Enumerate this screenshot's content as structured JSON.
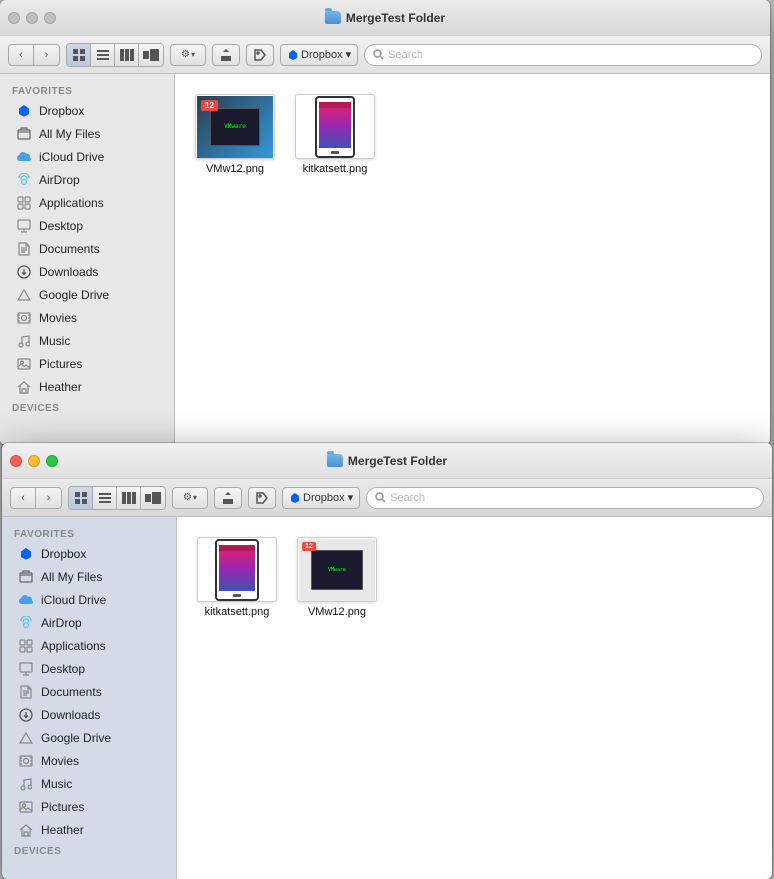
{
  "window1": {
    "title": "MergeTest Folder",
    "active": false,
    "sidebar": {
      "section": "Favorites",
      "items": [
        {
          "id": "dropbox",
          "label": "Dropbox",
          "icon": "dropbox"
        },
        {
          "id": "all-my-files",
          "label": "All My Files",
          "icon": "files"
        },
        {
          "id": "icloud-drive",
          "label": "iCloud Drive",
          "icon": "icloud"
        },
        {
          "id": "airdrop",
          "label": "AirDrop",
          "icon": "airdrop"
        },
        {
          "id": "applications",
          "label": "Applications",
          "icon": "apps"
        },
        {
          "id": "desktop",
          "label": "Desktop",
          "icon": "desktop"
        },
        {
          "id": "documents",
          "label": "Documents",
          "icon": "docs"
        },
        {
          "id": "downloads",
          "label": "Downloads",
          "icon": "downloads"
        },
        {
          "id": "google-drive",
          "label": "Google Drive",
          "icon": "gdrive"
        },
        {
          "id": "movies",
          "label": "Movies",
          "icon": "movies"
        },
        {
          "id": "music",
          "label": "Music",
          "icon": "music"
        },
        {
          "id": "pictures",
          "label": "Pictures",
          "icon": "pictures"
        },
        {
          "id": "heather",
          "label": "Heather",
          "icon": "home"
        }
      ],
      "devices_label": "Devices"
    },
    "files": [
      {
        "name": "VMw12.png",
        "type": "vmw12"
      },
      {
        "name": "kitkatsett.png",
        "type": "kitkat"
      }
    ],
    "toolbar": {
      "search_placeholder": "Search",
      "dropbox_label": "Dropbox ▾"
    }
  },
  "window2": {
    "title": "MergeTest Folder",
    "active": true,
    "sidebar": {
      "section": "Favorites",
      "items": [
        {
          "id": "dropbox",
          "label": "Dropbox",
          "icon": "dropbox"
        },
        {
          "id": "all-my-files",
          "label": "All My Files",
          "icon": "files"
        },
        {
          "id": "icloud-drive",
          "label": "iCloud Drive",
          "icon": "icloud"
        },
        {
          "id": "airdrop",
          "label": "AirDrop",
          "icon": "airdrop"
        },
        {
          "id": "applications",
          "label": "Applications",
          "icon": "apps"
        },
        {
          "id": "desktop",
          "label": "Desktop",
          "icon": "desktop"
        },
        {
          "id": "documents",
          "label": "Documents",
          "icon": "docs"
        },
        {
          "id": "downloads",
          "label": "Downloads",
          "icon": "downloads"
        },
        {
          "id": "google-drive",
          "label": "Google Drive",
          "icon": "gdrive"
        },
        {
          "id": "movies",
          "label": "Movies",
          "icon": "movies"
        },
        {
          "id": "music",
          "label": "Music",
          "icon": "music"
        },
        {
          "id": "pictures",
          "label": "Pictures",
          "icon": "pictures"
        },
        {
          "id": "heather",
          "label": "Heather",
          "icon": "home"
        }
      ],
      "devices_label": "Devices"
    },
    "files": [
      {
        "name": "kitkatsett.png",
        "type": "kitkat"
      },
      {
        "name": "VMw12.png",
        "type": "vmw12"
      }
    ],
    "toolbar": {
      "search_placeholder": "Search",
      "dropbox_label": "Dropbox ▾"
    }
  }
}
